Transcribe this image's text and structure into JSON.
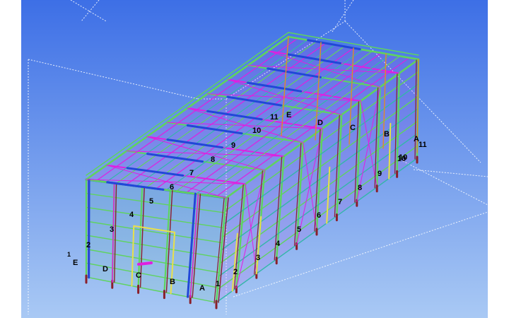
{
  "viewport": {
    "background": {
      "top": "#3d6fe6",
      "bottom": "#a9c9f4"
    },
    "colors": {
      "green": "#5fd35f",
      "magenta": "#e01fe0",
      "blue": "#2147d8",
      "yellow": "#e8e04a",
      "dark_red": "#8a1f2a",
      "teal": "#33b7a8",
      "orange": "#e08a2a",
      "work_area": "#ffffff"
    },
    "grid_labels": {
      "front_rows": [
        "1",
        "E",
        "D",
        "C",
        "B",
        "A"
      ],
      "front_row_markers": [
        "1"
      ],
      "long_axis": [
        "2",
        "3",
        "4",
        "5",
        "6",
        "7",
        "8",
        "9",
        "10"
      ],
      "back_rows": [
        "11",
        "E",
        "D",
        "C",
        "B",
        "A",
        "11",
        "10"
      ],
      "roof_axis": [
        "11",
        "10",
        "9",
        "8",
        "7",
        "6",
        "5",
        "4",
        "3",
        "2"
      ]
    }
  }
}
